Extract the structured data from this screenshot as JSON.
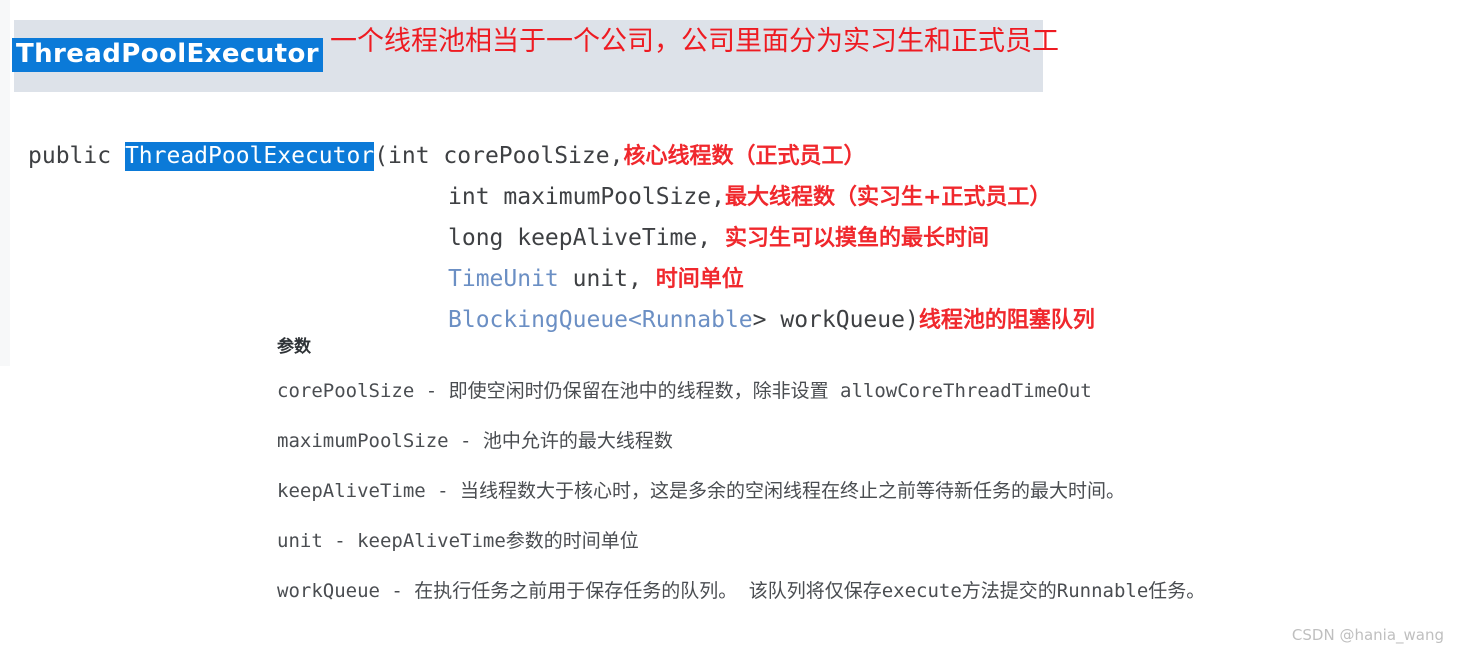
{
  "colors": {
    "highlight_blue": "#0b7ad8",
    "annotation_red": "#f0282d",
    "header_band": "#dde2e9",
    "code_text": "#3e4043",
    "code_link": "#6b8fc4",
    "watermark": "#bfbfbf"
  },
  "header": {
    "class_name": "ThreadPoolExecutor",
    "note": "一个线程池相当于一个公司，公司里面分为实习生和正式员工"
  },
  "signature": {
    "lines": [
      {
        "modifier": "public ",
        "highlighted": "ThreadPoolExecutor",
        "code": "(int corePoolSize,",
        "annotation": "核心线程数（正式员工）",
        "indent": false
      },
      {
        "modifier": "",
        "highlighted": "",
        "code": "int maximumPoolSize,",
        "annotation": "最大线程数（实习生+正式员工）",
        "indent": true
      },
      {
        "modifier": "",
        "highlighted": "",
        "code": "long keepAliveTime, ",
        "annotation": "实习生可以摸鱼的最长时间",
        "indent": true
      },
      {
        "modifier": "",
        "link": "TimeUnit",
        "code": " unit, ",
        "annotation": "时间单位",
        "indent": true
      },
      {
        "modifier": "",
        "link": "BlockingQueue",
        "generic_open": "<",
        "link2": "Runnable",
        "generic_close": "> workQueue)",
        "code": "",
        "annotation": "线程池的阻塞队列",
        "indent": true
      }
    ]
  },
  "params": {
    "heading": "参数",
    "rows": [
      {
        "name": "corePoolSize",
        "dash": " - ",
        "desc": "即使空闲时仍保留在池中的线程数，除非设置 allowCoreThreadTimeOut"
      },
      {
        "name": "maximumPoolSize",
        "dash": " - ",
        "desc": "池中允许的最大线程数"
      },
      {
        "name": "keepAliveTime",
        "dash": " - ",
        "desc": "当线程数大于核心时，这是多余的空闲线程在终止之前等待新任务的最大时间。"
      },
      {
        "name": "unit",
        "dash": " - ",
        "desc": "keepAliveTime参数的时间单位"
      },
      {
        "name": "workQueue",
        "dash": " - ",
        "desc": "在执行任务之前用于保存任务的队列。 该队列将仅保存execute方法提交的Runnable任务。"
      }
    ]
  },
  "watermark": {
    "text": "CSDN @hania_wang"
  }
}
